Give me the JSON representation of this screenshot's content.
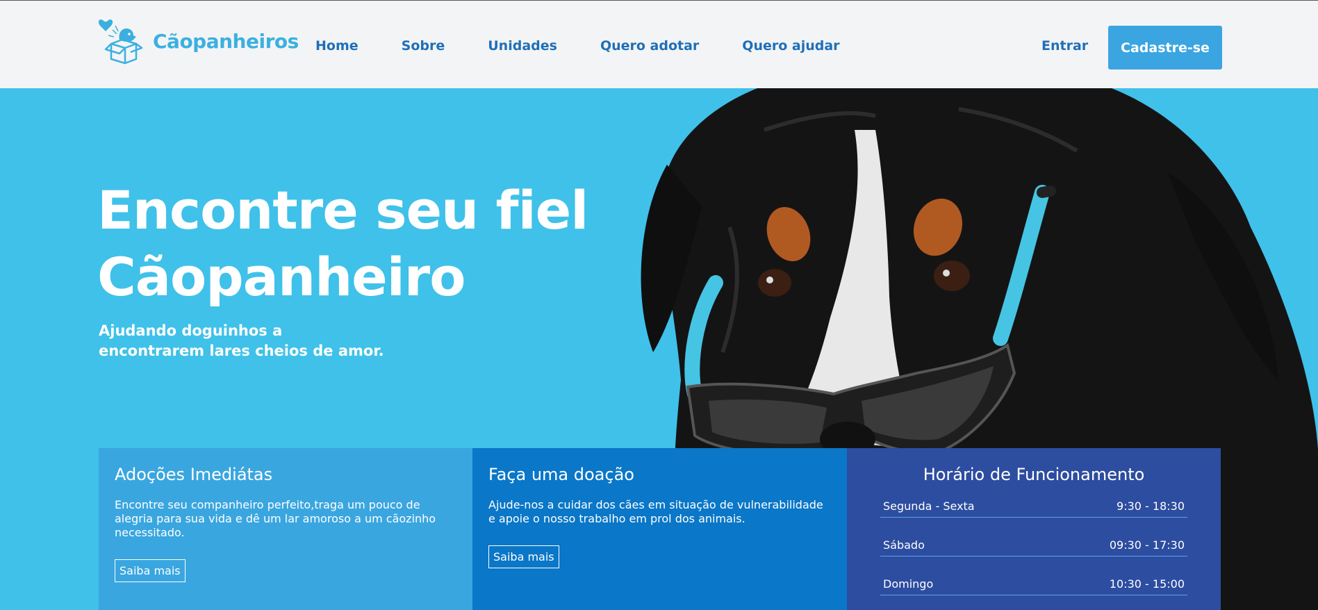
{
  "brand": {
    "name": "Cãopanheiros",
    "logo_icon": "dog-in-box-with-heart-icon",
    "color": "#3bb0e0"
  },
  "nav": {
    "items": [
      "Home",
      "Sobre",
      "Unidades",
      "Quero adotar",
      "Quero ajudar"
    ],
    "login_label": "Entrar",
    "signup_label": "Cadastre-se"
  },
  "hero": {
    "title_line1": "Encontre seu fiel",
    "title_line2": "Cãopanheiro",
    "subtitle_line1": "Ajudando doguinhos a",
    "subtitle_line2": "encontrarem lares cheios de amor.",
    "background_color": "#3fc1ea",
    "image": "dog-with-sunglasses"
  },
  "cards": [
    {
      "title": "Adoções Imediátas",
      "text": "Encontre seu companheiro perfeito,traga um pouco de alegria para sua vida e dê um lar amoroso a um cãozinho necessitado.",
      "button": "Saiba mais",
      "color": "#3aa6e0"
    },
    {
      "title": "Faça uma doação",
      "text": "Ajude-nos a cuidar dos cães em situação de vulnerabilidade e apoie o nosso trabalho em prol dos animais.",
      "button": "Saiba mais",
      "color": "#0a77c8"
    }
  ],
  "hours": {
    "title": "Horário de Funcionamento",
    "rows": [
      {
        "day": "Segunda - Sexta",
        "time": "9:30 - 18:30"
      },
      {
        "day": "Sábado",
        "time": "09:30 - 17:30"
      },
      {
        "day": "Domingo",
        "time": "10:30 - 15:00"
      }
    ],
    "color": "#2d4da0"
  }
}
